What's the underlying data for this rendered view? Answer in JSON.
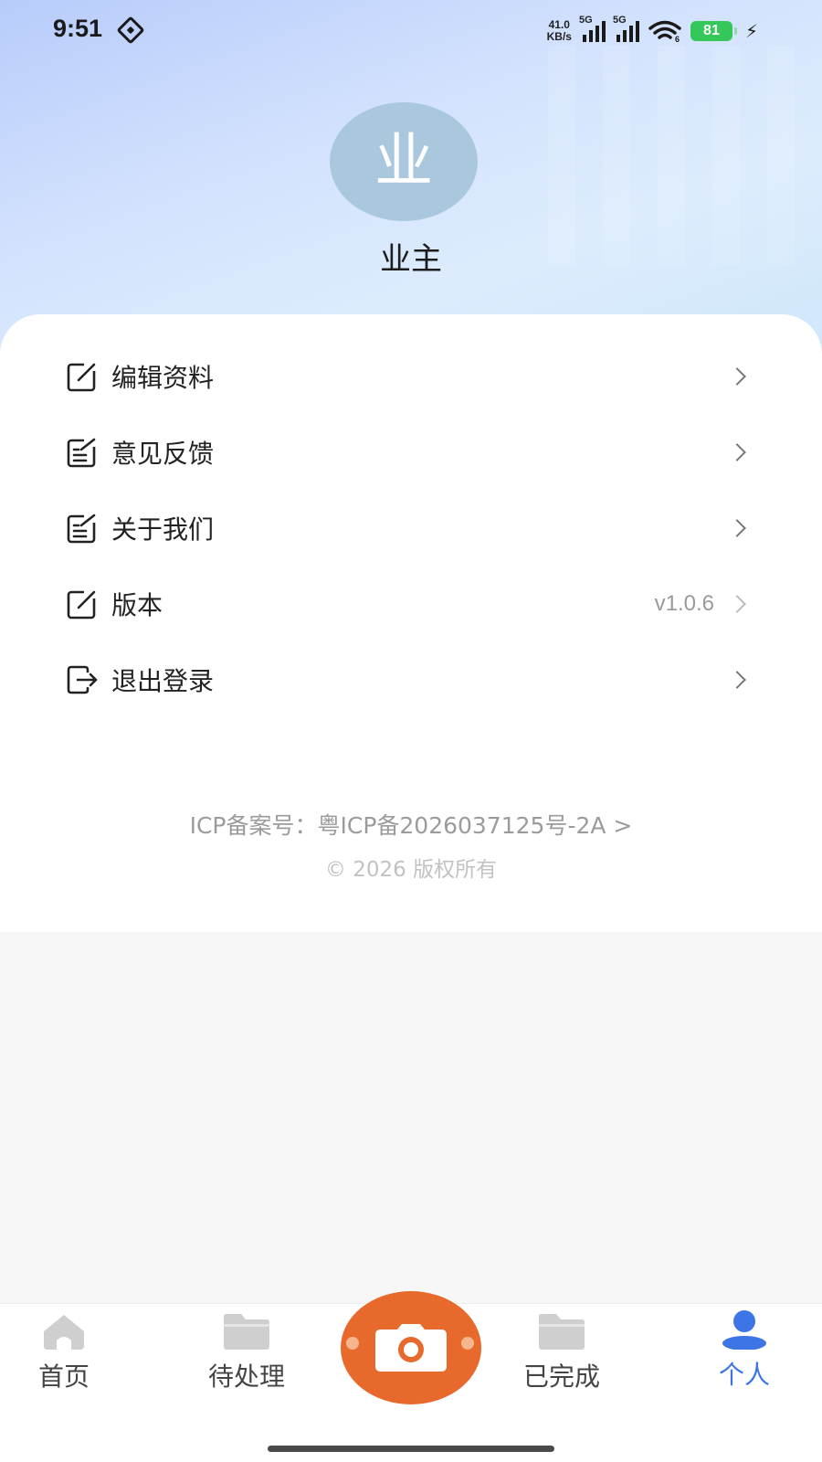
{
  "status_bar": {
    "time": "9:51",
    "net_speed_value": "41.0",
    "net_speed_unit": "KB/s",
    "signal1_label": "5G",
    "signal2_label": "5G",
    "wifi_suffix": "6",
    "battery": "81"
  },
  "profile": {
    "avatar_char": "业",
    "name": "业主"
  },
  "menu": {
    "items": [
      {
        "label": "编辑资料",
        "icon": "edit-icon"
      },
      {
        "label": "意见反馈",
        "icon": "feedback-icon"
      },
      {
        "label": "关于我们",
        "icon": "about-icon"
      },
      {
        "label": "版本",
        "icon": "version-icon",
        "value": "v1.0.6"
      },
      {
        "label": "退出登录",
        "icon": "logout-icon"
      }
    ]
  },
  "footer": {
    "icp": "ICP备案号：粤ICP备2026037125号-2A >",
    "copyright": "© 2026 版权所有"
  },
  "tabbar": {
    "tabs": [
      {
        "label": "首页",
        "icon": "home-icon"
      },
      {
        "label": "待处理",
        "icon": "folder-icon"
      },
      {
        "label": "已完成",
        "icon": "folder-icon"
      },
      {
        "label": "个人",
        "icon": "user-icon",
        "active": true
      }
    ],
    "center_button_icon": "camera-icon",
    "active_color": "#3d74e6",
    "camera_color": "#e8692c"
  }
}
